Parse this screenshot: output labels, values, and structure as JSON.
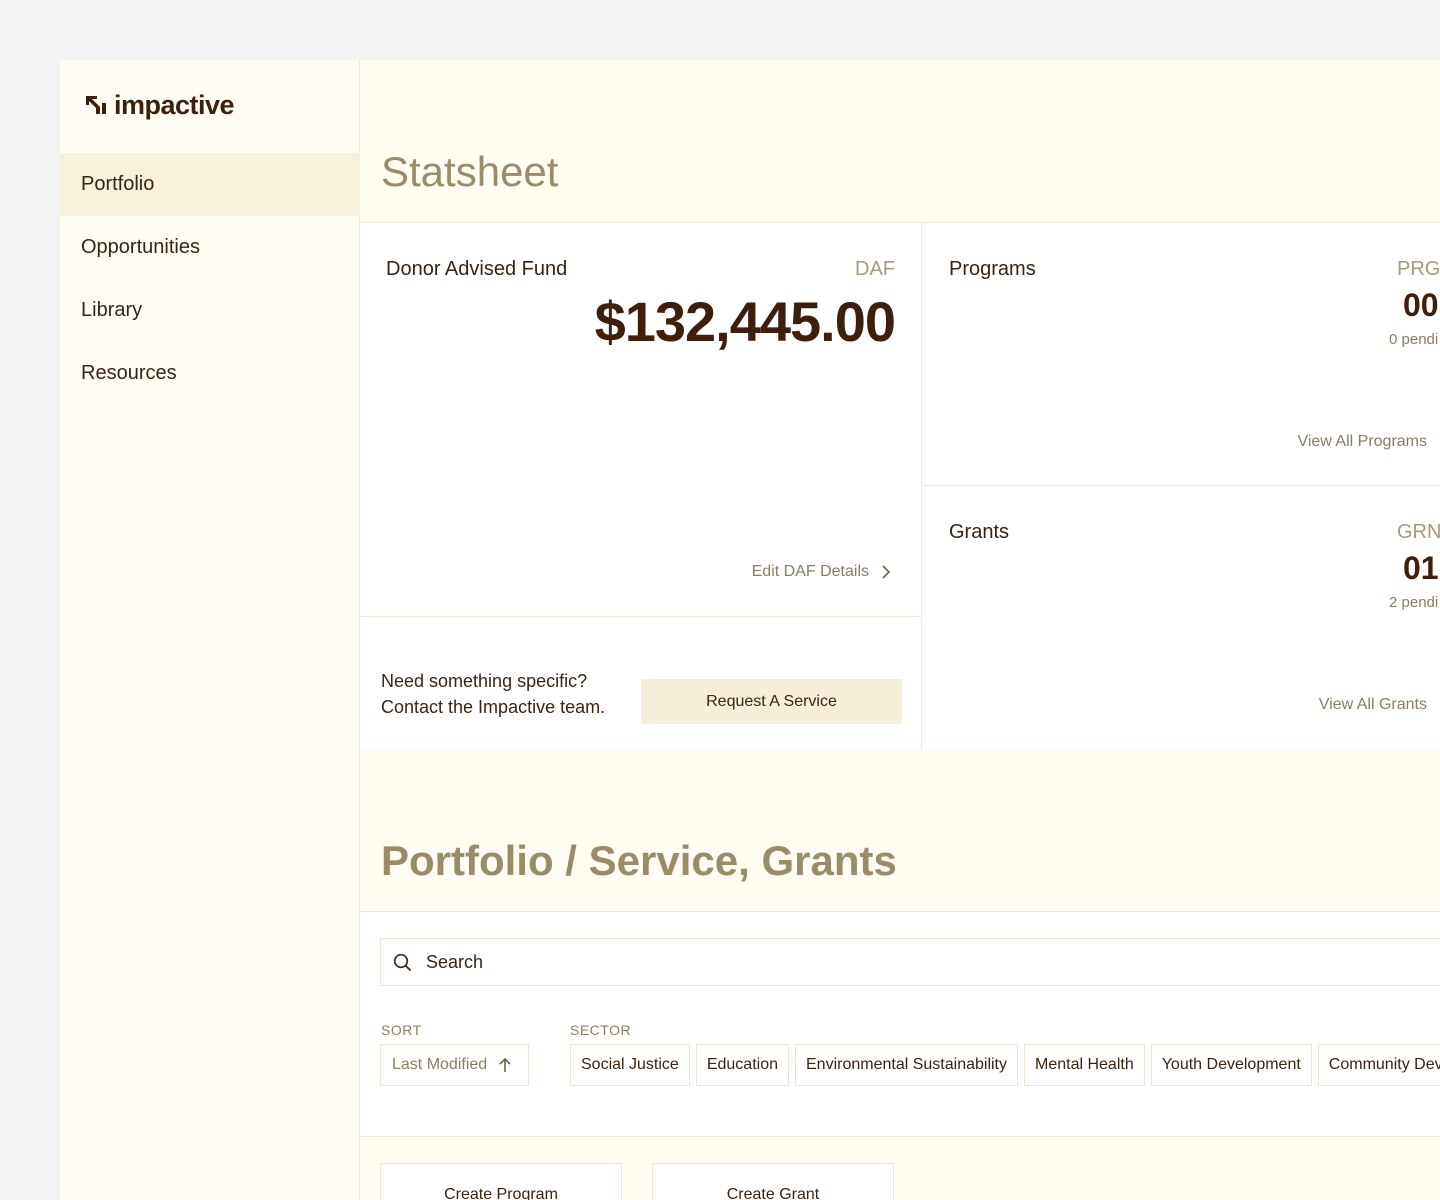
{
  "brand": {
    "name": "impactive"
  },
  "sidebar": {
    "items": [
      {
        "label": "Portfolio",
        "active": true
      },
      {
        "label": "Opportunities",
        "active": false
      },
      {
        "label": "Library",
        "active": false
      },
      {
        "label": "Resources",
        "active": false
      }
    ]
  },
  "statsheet": {
    "title": "Statsheet",
    "daf": {
      "title": "Donor Advised Fund",
      "code": "DAF",
      "amount": "$132,445.00",
      "edit_label": "Edit DAF Details"
    },
    "service": {
      "line1": "Need something specific?",
      "line2": "Contact the Impactive team.",
      "button_label": "Request A Service"
    },
    "programs": {
      "title": "Programs",
      "code": "PRG",
      "count": "00",
      "pending": "0 pendi",
      "view_all": "View All Programs"
    },
    "grants": {
      "title": "Grants",
      "code": "GRN",
      "count": "01",
      "pending": "2 pendi",
      "view_all": "View All Grants"
    }
  },
  "portfolio": {
    "title": "Portfolio / Service, Grants",
    "search": {
      "placeholder": "Search",
      "value": ""
    },
    "sort": {
      "label": "SORT",
      "value": "Last Modified"
    },
    "sector": {
      "label": "SECTOR",
      "options": [
        "Social Justice",
        "Education",
        "Environmental Sustainability",
        "Mental Health",
        "Youth Development",
        "Community Dev"
      ]
    },
    "actions": {
      "create_program": "Create Program",
      "create_grant": "Create Grant"
    }
  },
  "colors": {
    "accent_text": "#3d1f0b",
    "muted_heading": "#9a8c66",
    "active_nav_bg": "#f6f0dd",
    "button_bg": "#f5eed8",
    "page_bg": "#fffcf2"
  },
  "icons": [
    "logo-mark-icon",
    "chevron-right-icon",
    "search-icon",
    "arrow-up-icon"
  ]
}
